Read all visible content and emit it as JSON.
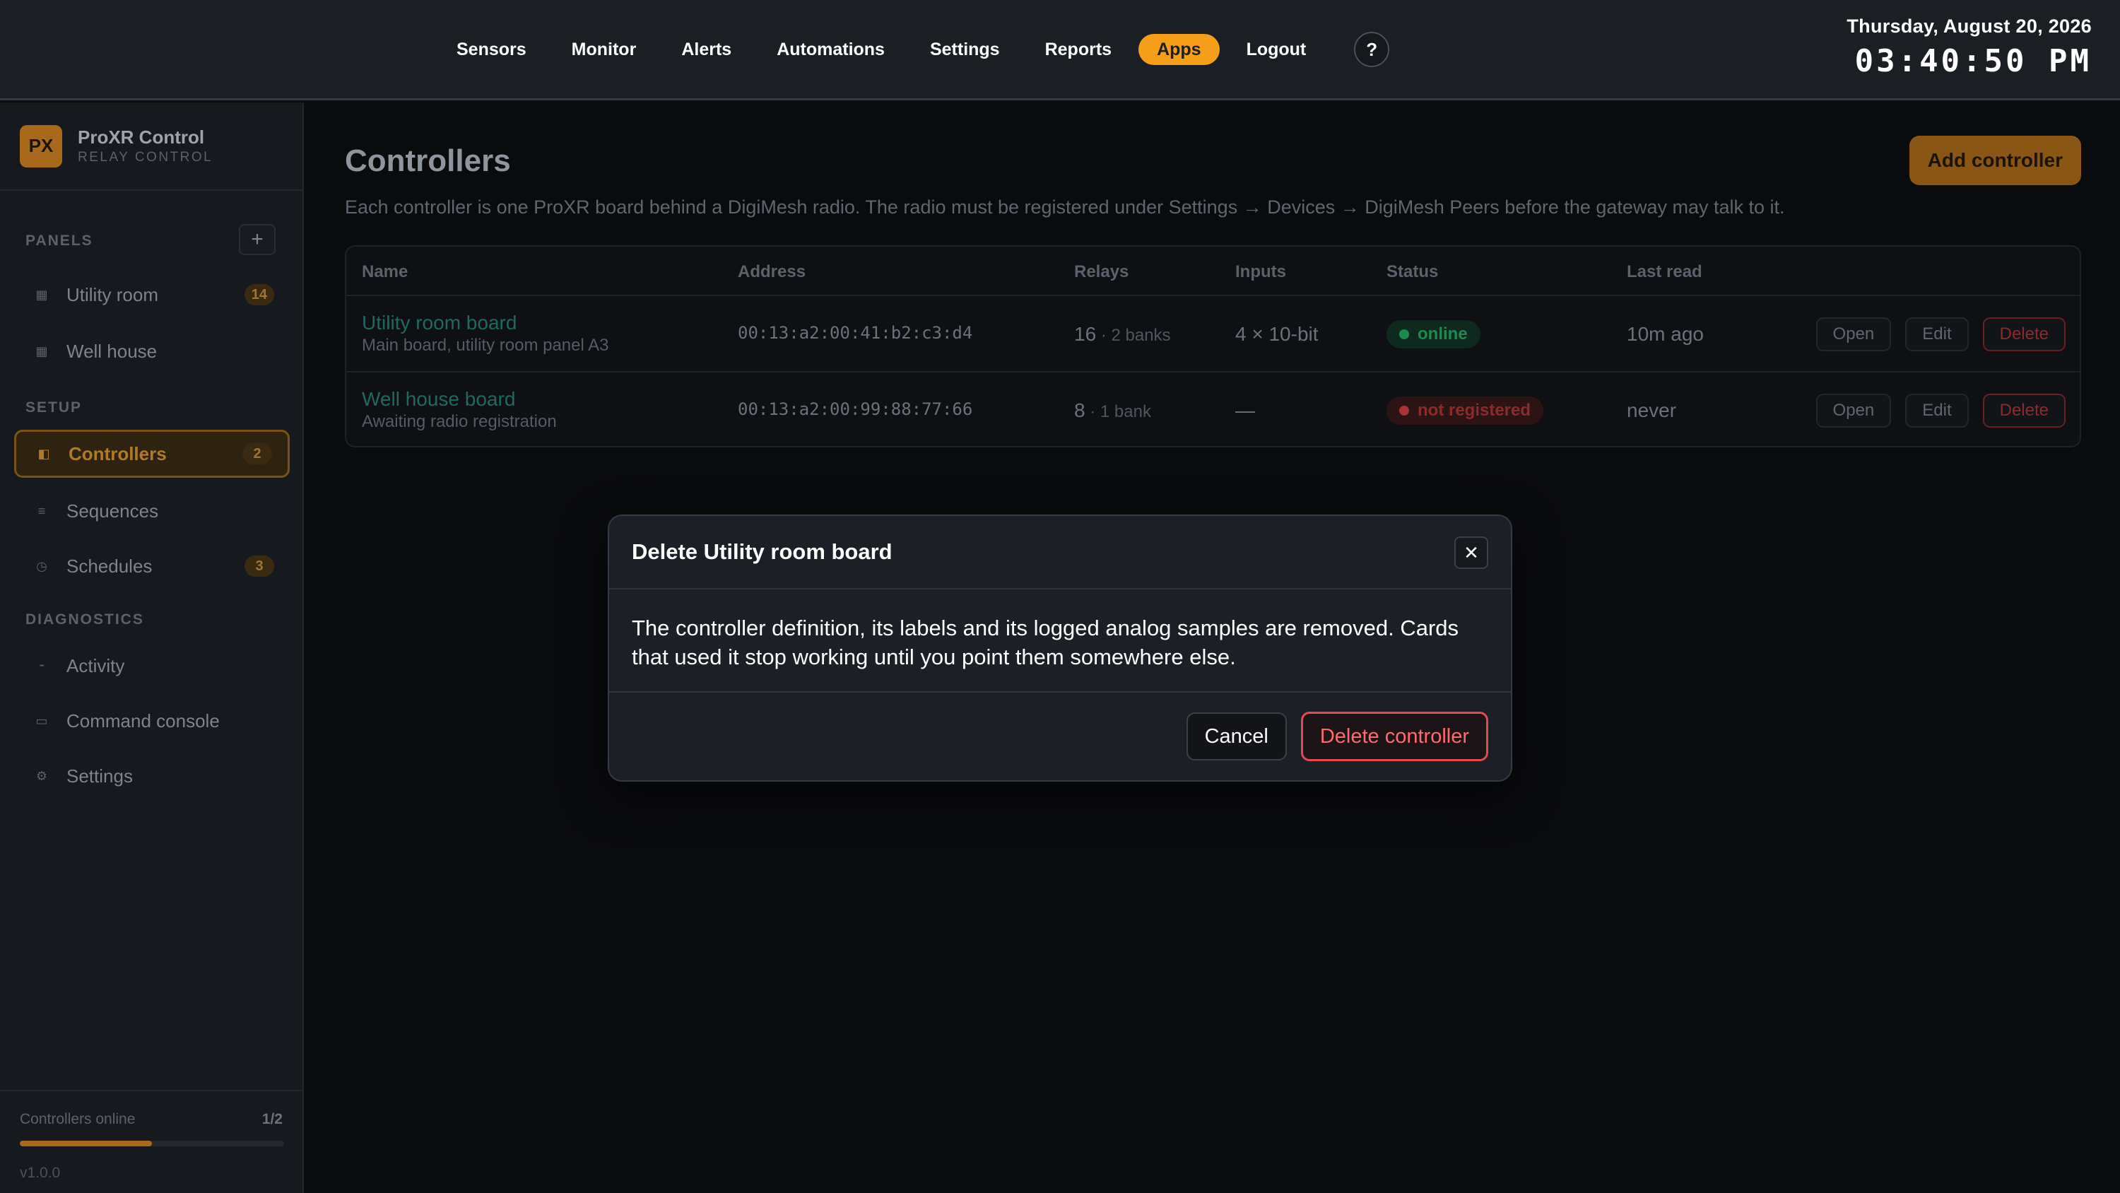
{
  "nav": {
    "items": [
      "Sensors",
      "Monitor",
      "Alerts",
      "Automations",
      "Settings",
      "Reports",
      "Apps",
      "Logout"
    ],
    "active": "Apps",
    "help_label": "?"
  },
  "clock": {
    "date": "Thursday, August 20, 2026",
    "time": "03:40:50 PM"
  },
  "brand": {
    "logo": "PX",
    "title": "ProXR Control",
    "subtitle": "RELAY CONTROL"
  },
  "sidebar": {
    "sections": {
      "panels": "PANELS",
      "setup": "SETUP",
      "diagnostics": "DIAGNOSTICS"
    },
    "add_panel_label": "+",
    "items": [
      {
        "label": "Utility room",
        "badge": "14",
        "icon": "panel-icon"
      },
      {
        "label": "Well house",
        "badge": "",
        "icon": "panel-icon"
      },
      {
        "label": "Controllers",
        "badge": "2",
        "icon": "controller-icon",
        "active": true
      },
      {
        "label": "Sequences",
        "badge": "",
        "icon": "list-icon"
      },
      {
        "label": "Schedules",
        "badge": "3",
        "icon": "clock-icon"
      },
      {
        "label": "Activity",
        "badge": "",
        "icon": "activity-icon"
      },
      {
        "label": "Command console",
        "badge": "",
        "icon": "console-icon"
      },
      {
        "label": "Settings",
        "badge": "",
        "icon": "gear-icon"
      }
    ],
    "footer": {
      "label": "Controllers online",
      "count": "1/2",
      "progress": 0.5,
      "version": "v1.0.0"
    }
  },
  "page": {
    "title": "Controllers",
    "description": "Each controller is one ProXR board behind a DigiMesh radio. The radio must be registered under Settings → Devices → DigiMesh Peers before the gateway may talk to it.",
    "add_button": "Add controller"
  },
  "table": {
    "columns": [
      "Name",
      "Address",
      "Relays",
      "Inputs",
      "Status",
      "Last read"
    ],
    "rows": [
      {
        "name": "Utility room board",
        "subtitle": "Main board, utility room panel A3",
        "address": "00:13:a2:00:41:b2:c3:d4",
        "relays": "16",
        "banks": " · 2 banks",
        "inputs": "4 × 10-bit",
        "status": "online",
        "last_read": "10m ago"
      },
      {
        "name": "Well house board",
        "subtitle": "Awaiting radio registration",
        "address": "00:13:a2:00:99:88:77:66",
        "relays": "8",
        "banks": " · 1 bank",
        "inputs": "—",
        "status": "not registered",
        "last_read": "never"
      }
    ],
    "actions": {
      "open": "Open",
      "edit": "Edit",
      "delete": "Delete"
    }
  },
  "modal": {
    "title": "Delete Utility room board",
    "close_label": "✕",
    "body": "The controller definition, its labels and its logged analog samples are removed. Cards that used it stop working until you point them somewhere else.",
    "cancel": "Cancel",
    "confirm": "Delete controller"
  },
  "colors": {
    "accent": "#f59e1a",
    "danger": "#e24b4f",
    "online": "#1f8a4e"
  }
}
